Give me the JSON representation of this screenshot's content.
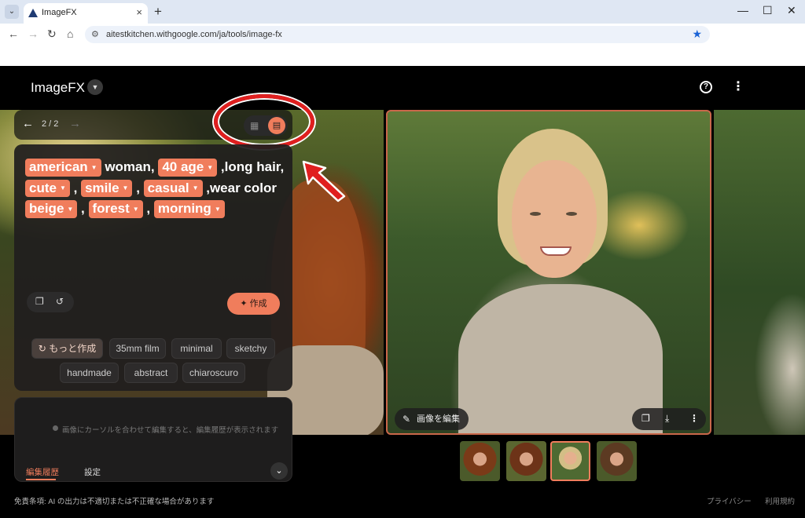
{
  "browser": {
    "tab_title": "ImageFX",
    "tab_close": "×",
    "new_tab": "+",
    "url": "aitestkitchen.withgoogle.com/ja/tools/image-fx",
    "window_controls": {
      "minimize": "—",
      "maximize": "☐",
      "close": "✕"
    }
  },
  "app": {
    "logo": "ImageFX",
    "nav": {
      "counter": "2 / 2"
    },
    "prompt": {
      "segments": [
        {
          "type": "chip",
          "text": "american"
        },
        {
          "type": "text",
          "text": "  woman, "
        },
        {
          "type": "chip",
          "text": "40 age"
        },
        {
          "type": "text",
          "text": " ,long hair, "
        },
        {
          "type": "chip",
          "text": "cute"
        },
        {
          "type": "text",
          "text": " , "
        },
        {
          "type": "chip",
          "text": "smile"
        },
        {
          "type": "text",
          "text": " , "
        },
        {
          "type": "chip",
          "text": "casual"
        },
        {
          "type": "text",
          "text": " ,wear color "
        },
        {
          "type": "chip",
          "text": "beige"
        },
        {
          "type": "text",
          "text": " , "
        },
        {
          "type": "chip",
          "text": "forest"
        },
        {
          "type": "text",
          "text": " , "
        },
        {
          "type": "chip",
          "text": "morning"
        }
      ]
    },
    "create_button": "作成",
    "suggestions": {
      "more": "もっと作成",
      "items": [
        "35mm film",
        "minimal",
        "sketchy",
        "handmade",
        "abstract",
        "chiaroscuro"
      ]
    },
    "image_actions": {
      "edit": "画像を編集"
    },
    "history": {
      "message": "画像にカーソルを合わせて編集すると、編集履歴が表示されます",
      "tab_history": "編集履歴",
      "tab_settings": "設定"
    },
    "footer": {
      "disclaimer": "免責条項: AI の出力は不適切または不正確な場合があります",
      "privacy": "プライバシー",
      "terms": "利用規約"
    }
  },
  "colors": {
    "accent": "#f07d5c",
    "callout": "#e01f1f"
  }
}
